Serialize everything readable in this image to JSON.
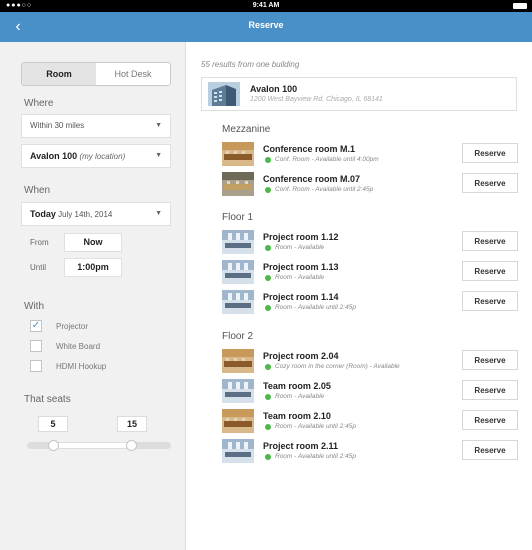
{
  "status_bar": {
    "signal": "●●●○○ ",
    "time": "9:41 AM"
  },
  "nav": {
    "back": "‹",
    "title": "Reserve"
  },
  "sidebar": {
    "segments": [
      {
        "label": "Room",
        "active": true
      },
      {
        "label": "Hot Desk",
        "active": false
      }
    ],
    "where_label": "Where",
    "distance": "Within 30 miles",
    "location_building": "Avalon 100",
    "location_note": "(my location)",
    "when_label": "When",
    "date_bold": "Today",
    "date_rest": "July 14th, 2014",
    "from_label": "From",
    "from_value": "Now",
    "until_label": "Until",
    "until_value": "1:00pm",
    "with_label": "With",
    "amenities": [
      {
        "label": "Projector",
        "checked": true
      },
      {
        "label": "White Board",
        "checked": false
      },
      {
        "label": "HDMI Hookup",
        "checked": false
      }
    ],
    "seats_label": "That seats",
    "seats_min": "5",
    "seats_max": "15",
    "seat_range_fraction": [
      0.18,
      0.72
    ],
    "check_mark": "✓",
    "caret": "▼"
  },
  "main": {
    "results_count": "55 results from one building",
    "building": {
      "name": "Avalon 100",
      "address": "1200 West Bayview Rd. Chicago, IL 68141"
    },
    "reserve_label": "Reserve",
    "floors": [
      {
        "name": "Mezzanine",
        "rooms": [
          {
            "name": "Conference room M.1",
            "status": "Conf. Room - Available until 4:00pm",
            "thumb": "conference"
          },
          {
            "name": "Conference room M.07",
            "status": "Conf. Room - Available until 2:45p",
            "thumb": "conference-dark"
          }
        ]
      },
      {
        "name": "Floor 1",
        "rooms": [
          {
            "name": "Project room 1.12",
            "status": "Room - Available",
            "thumb": "project"
          },
          {
            "name": "Project room 1.13",
            "status": "Room - Available",
            "thumb": "project"
          },
          {
            "name": "Project room 1.14",
            "status": "Room - Available until 2:45p",
            "thumb": "project"
          }
        ]
      },
      {
        "name": "Floor 2",
        "rooms": [
          {
            "name": "Project room 2.04",
            "status": "Cozy room in the corner (Room) - Available",
            "thumb": "conference"
          },
          {
            "name": "Team room 2.05",
            "status": "Room - Available",
            "thumb": "project"
          },
          {
            "name": "Team room 2.10",
            "status": "Room - Available until 2:45p",
            "thumb": "conference"
          },
          {
            "name": "Project room 2.11",
            "status": "Room - Available until 2:45p",
            "thumb": "project"
          }
        ]
      }
    ]
  },
  "colors": {
    "nav": "#4a90c8",
    "available_dot": "#4cb84c",
    "sidebar_bg": "#f1f1f1"
  }
}
